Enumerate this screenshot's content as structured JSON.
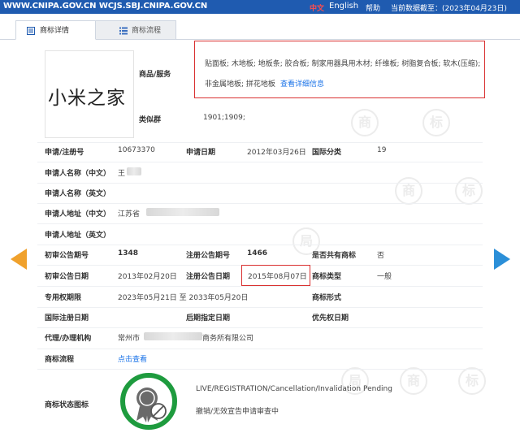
{
  "topbar": {
    "sites": "WWW.CNIPA.GOV.CN WCJS.SBJ.CNIPA.GOV.CN",
    "lang_zh": "中文",
    "lang_en": "English",
    "help": "帮助",
    "data_cutoff": "当前数据截至：(2023年04月23日)"
  },
  "tabs": [
    {
      "label": "商标详情",
      "icon": "document-icon",
      "active": true
    },
    {
      "label": "商标流程",
      "icon": "list-icon",
      "active": false
    }
  ],
  "logo_text": "小米之家",
  "goods": {
    "label": "商品/服务",
    "line1": "贴面板; 木地板; 地板条; 胶合板; 制家用器具用木材; 纤维板; 树脂复合板; 软木(压缩);",
    "line2": "非金属地板; 拼花地板",
    "more_link": "查看详细信息"
  },
  "similar_group": {
    "label": "类似群",
    "value": "1901;1909;"
  },
  "reg_number": {
    "label": "申请/注册号",
    "value": "10673370"
  },
  "app_date": {
    "label": "申请日期",
    "value": "2012年03月26日"
  },
  "intl_class": {
    "label": "国际分类",
    "value": "19"
  },
  "applicant_cn": {
    "label": "申请人名称（中文）",
    "value": "王"
  },
  "applicant_en": {
    "label": "申请人名称（英文）",
    "value": ""
  },
  "address_cn": {
    "label": "申请人地址（中文）",
    "value": "江苏省"
  },
  "address_en": {
    "label": "申请人地址（英文）",
    "value": ""
  },
  "prelim_issue": {
    "label": "初审公告期号",
    "value": "1348"
  },
  "reg_issue": {
    "label": "注册公告期号",
    "value": "1466"
  },
  "shared": {
    "label": "是否共有商标",
    "value": "否"
  },
  "prelim_date": {
    "label": "初审公告日期",
    "value": "2013年02月20日"
  },
  "reg_date": {
    "label": "注册公告日期",
    "value": "2015年08月07日"
  },
  "mark_type": {
    "label": "商标类型",
    "value": "一般"
  },
  "exclusive_period": {
    "label": "专用权期限",
    "value": "2023年05月21日 至 2033年05月20日"
  },
  "mark_form": {
    "label": "商标形式",
    "value": ""
  },
  "intl_reg_date": {
    "label": "国际注册日期",
    "value": ""
  },
  "later_date": {
    "label": "后期指定日期",
    "value": ""
  },
  "priority_date": {
    "label": "优先权日期",
    "value": ""
  },
  "agent": {
    "label": "代理/办理机构",
    "value_prefix": "常州市",
    "value_suffix": "商务所有限公司"
  },
  "process": {
    "label": "商标流程",
    "link": "点击查看"
  },
  "status": {
    "label": "商标状态图标",
    "en": "LIVE/REGISTRATION/Cancellation/Invalidation Pending",
    "zh": "撤销/无效宣告申请审查中"
  },
  "colors": {
    "topbar": "#1f5bb0",
    "highlight": "#d93030",
    "link": "#1a73e8",
    "arrow_left": "#f0a12c",
    "arrow_right": "#2b8fd8",
    "seal": "#1e9b3e"
  }
}
